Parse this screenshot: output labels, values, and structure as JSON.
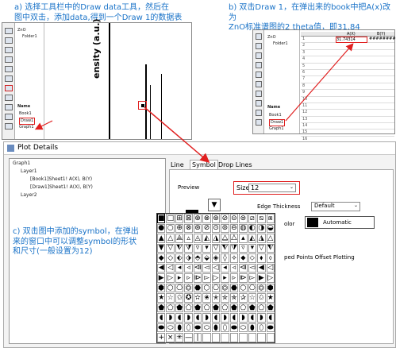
{
  "annotations": {
    "a": "a) 选择工具栏中的Draw data工具，然后在\n图中双击，添加data,得到一个Draw 1的数据表",
    "b": "b) 双击Draw 1，在弹出来的book中把A(x)改为\nZnO标准谱图的2 theta值，即31.84",
    "c": "c) 双击图中添加的symbol，在弹出\n来的窗口中可以调整symbol的形状\n和尺寸(一般设置为12)"
  },
  "left_window": {
    "tree": [
      "ZnO",
      "Folder1"
    ],
    "list_header": "Name",
    "list_items": [
      "Book1",
      "Draw1",
      "Graph1"
    ],
    "axis_label": "ensity (a.u.)"
  },
  "right_window": {
    "tree": [
      "ZnO",
      "Folder1"
    ],
    "list_header": "Name",
    "list_items": [
      "Book1",
      "Draw1",
      "Graph1"
    ],
    "columns": [
      "A(X)",
      "B(Y)"
    ],
    "rows": [
      {
        "row": "1",
        "a": "31.74314",
        "b": "##########"
      },
      {
        "row": "2",
        "a": "",
        "b": ""
      },
      {
        "row": "3",
        "a": "",
        "b": ""
      },
      {
        "row": "4",
        "a": "",
        "b": ""
      },
      {
        "row": "5",
        "a": "",
        "b": ""
      },
      {
        "row": "6",
        "a": "",
        "b": ""
      },
      {
        "row": "7",
        "a": "",
        "b": ""
      },
      {
        "row": "8",
        "a": "",
        "b": ""
      },
      {
        "row": "9",
        "a": "",
        "b": ""
      },
      {
        "row": "10",
        "a": "",
        "b": ""
      },
      {
        "row": "11",
        "a": "",
        "b": ""
      },
      {
        "row": "12",
        "a": "",
        "b": ""
      },
      {
        "row": "13",
        "a": "",
        "b": ""
      },
      {
        "row": "14",
        "a": "",
        "b": ""
      },
      {
        "row": "15",
        "a": "",
        "b": ""
      },
      {
        "row": "16",
        "a": "",
        "b": ""
      }
    ]
  },
  "plot_details": {
    "title": "Plot Details",
    "tree": {
      "graph": "Graph1",
      "layer1": "Layer1",
      "plot1": "[Book1]Sheet1! A(X), B(Y)",
      "plot2": "[Draw1]Sheet1! A(X), B(Y)",
      "layer2": "Layer2"
    },
    "tabs": [
      "Line",
      "Symbol",
      "Drop Lines"
    ],
    "active_tab": "Symbol",
    "preview_label": "Preview",
    "size_label": "Size",
    "size_value": "12",
    "edge_thickness_label": "Edge Thickness",
    "edge_thickness_value": "Default",
    "color_label_partial": "olor",
    "color_value": "Automatic",
    "offset_label_partial": "ped Points Offset Plotting",
    "size_partial": "ze"
  },
  "symbols": [
    "■",
    "□",
    "⊞",
    "⊠",
    "⊕",
    "⊗",
    "⊛",
    "⊘",
    "⊝",
    "⊜",
    "⧄",
    "⧅",
    "⧆",
    "●",
    "○",
    "⊕",
    "⊗",
    "⊛",
    "⊘",
    "⊙",
    "⊚",
    "⊖",
    "◍",
    "◐",
    "◑",
    "◒",
    "▲",
    "△",
    "⟁",
    "▵",
    "◬",
    "◭",
    "◮",
    "⧋",
    "⧊",
    "▴",
    "◭",
    "◮",
    "△",
    "▼",
    "▽",
    "⧨",
    "⧩",
    "▿",
    "▾",
    "▽",
    "⧨",
    "⧩",
    "▿",
    "▾",
    "▽",
    "⧨",
    "◆",
    "◇",
    "⬖",
    "⬗",
    "⬘",
    "⬙",
    "◈",
    "◊",
    "⟡",
    "⬥",
    "⬦",
    "⬧",
    "⬨",
    "◀",
    "◁",
    "◂",
    "◃",
    "⧏",
    "◅",
    "◁",
    "◂",
    "◃",
    "⧏",
    "◅",
    "◀",
    "◁",
    "▶",
    "▷",
    "▸",
    "▹",
    "⧐",
    "▻",
    "▷",
    "▸",
    "▹",
    "⧐",
    "▻",
    "▶",
    "▷",
    "⬢",
    "⬡",
    "⎔",
    "⏣",
    "⬣",
    "⬡",
    "⎔",
    "⏣",
    "⬣",
    "⬡",
    "⎔",
    "⏣",
    "⬢",
    "★",
    "☆",
    "✩",
    "✪",
    "✫",
    "✬",
    "✭",
    "✮",
    "✯",
    "✰",
    "☆",
    "✩",
    "★",
    "⬟",
    "⬠",
    "⬟",
    "⬠",
    "⬟",
    "⬠",
    "⬟",
    "⬠",
    "⬟",
    "⬠",
    "⬟",
    "⬠",
    "⬟",
    "◖",
    "◗",
    "◖",
    "◗",
    "◖",
    "◗",
    "◖",
    "◗",
    "◖",
    "◗",
    "◖",
    "◗",
    "◖",
    "⬬",
    "⬭",
    "⬮",
    "⬯",
    "⬬",
    "⬭",
    "⬮",
    "⬯",
    "⬬",
    "⬭",
    "⬮",
    "⬯",
    "⬬",
    "+",
    "×",
    "✳",
    "—",
    "|",
    "",
    "",
    "",
    "",
    "",
    "",
    "",
    ""
  ],
  "colors": {
    "annotation_text": "#1a73c8",
    "highlight_red": "#e02020"
  }
}
